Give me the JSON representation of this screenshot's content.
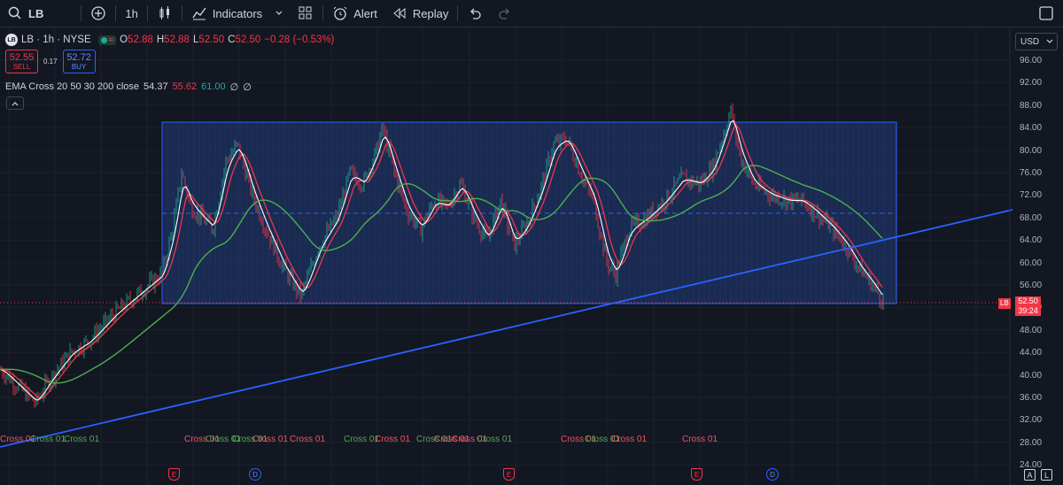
{
  "toolbar": {
    "symbol": "LB",
    "interval": "1h",
    "indicators_label": "Indicators",
    "alert_label": "Alert",
    "replay_label": "Replay"
  },
  "legend": {
    "symbol_line": "LB · 1h · NYSE",
    "logo_text": "LB",
    "open_key": "O",
    "open": "52.88",
    "high_key": "H",
    "high": "52.88",
    "low_key": "L",
    "low": "52.50",
    "close_key": "C",
    "close": "52.50",
    "change": "−0.28 (−0.53%)"
  },
  "trade": {
    "sell_price": "52.55",
    "sell_label": "SELL",
    "spread": "0.17",
    "buy_price": "52.72",
    "buy_label": "BUY"
  },
  "indicator": {
    "name": "EMA Cross 20 50 30 200 close",
    "v1": "54.37",
    "v2": "55.62",
    "v3": "61.00",
    "v4": "∅",
    "v5": "∅"
  },
  "price_scale": {
    "currency": "USD",
    "ticks": [
      "96.00",
      "92.00",
      "88.00",
      "84.00",
      "80.00",
      "76.00",
      "72.00",
      "68.00",
      "64.00",
      "60.00",
      "56.00",
      "52.00",
      "48.00",
      "44.00",
      "40.00",
      "36.00",
      "32.00",
      "28.00",
      "24.00"
    ],
    "last_symbol": "LB",
    "last_price": "52.50",
    "countdown": "39:24",
    "auto_label": "A",
    "log_label": "L"
  },
  "cross_labels": [
    {
      "text": "Cross 01",
      "color": "red"
    },
    {
      "text": "Cross 01",
      "color": "green"
    },
    {
      "text": "Cross 01",
      "color": "green"
    },
    {
      "text": "Cross 01",
      "color": "red"
    },
    {
      "text": "Cross 01",
      "color": "green"
    },
    {
      "text": "Cross 01",
      "color": "green"
    },
    {
      "text": "Cross 01",
      "color": "red"
    },
    {
      "text": "Cross 01",
      "color": "red"
    },
    {
      "text": "Cross 01",
      "color": "green"
    },
    {
      "text": "Cross 01",
      "color": "red"
    },
    {
      "text": "Cross 01",
      "color": "green"
    },
    {
      "text": "Cross 01",
      "color": "red"
    },
    {
      "text": "Cross 01",
      "color": "red"
    },
    {
      "text": "Cross 01",
      "color": "green"
    },
    {
      "text": "Cross 01",
      "color": "red"
    },
    {
      "text": "Cross 01",
      "color": "green"
    },
    {
      "text": "Cross 01",
      "color": "red"
    },
    {
      "text": "Cross 01",
      "color": "red"
    }
  ],
  "events": [
    {
      "type": "E"
    },
    {
      "type": "D"
    },
    {
      "type": "E"
    },
    {
      "type": "E"
    },
    {
      "type": "D"
    }
  ],
  "colors": {
    "background": "#131722",
    "up": "#22ab94",
    "down": "#f23645",
    "rectangle_fill": "#1e3260",
    "rectangle_border": "#2962ff",
    "trendline": "#2962ff",
    "ema_fast": "#ffffff",
    "ema_mid": "#f23645",
    "ema_slow": "#4caf50"
  }
}
